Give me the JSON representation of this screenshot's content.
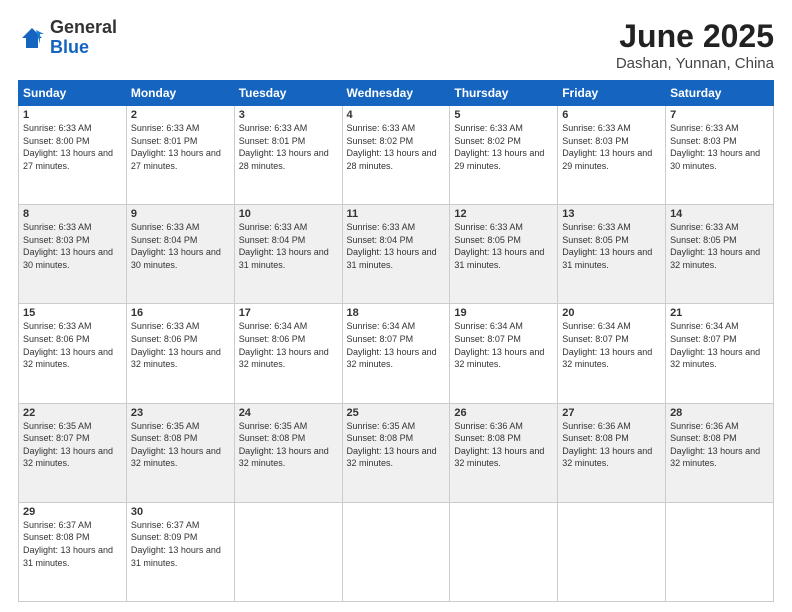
{
  "logo": {
    "general": "General",
    "blue": "Blue"
  },
  "title": {
    "month_year": "June 2025",
    "location": "Dashan, Yunnan, China"
  },
  "weekdays": [
    "Sunday",
    "Monday",
    "Tuesday",
    "Wednesday",
    "Thursday",
    "Friday",
    "Saturday"
  ],
  "weeks": [
    [
      {
        "day": "1",
        "sunrise": "6:33 AM",
        "sunset": "8:00 PM",
        "daylight": "13 hours and 27 minutes."
      },
      {
        "day": "2",
        "sunrise": "6:33 AM",
        "sunset": "8:01 PM",
        "daylight": "13 hours and 27 minutes."
      },
      {
        "day": "3",
        "sunrise": "6:33 AM",
        "sunset": "8:01 PM",
        "daylight": "13 hours and 28 minutes."
      },
      {
        "day": "4",
        "sunrise": "6:33 AM",
        "sunset": "8:02 PM",
        "daylight": "13 hours and 28 minutes."
      },
      {
        "day": "5",
        "sunrise": "6:33 AM",
        "sunset": "8:02 PM",
        "daylight": "13 hours and 29 minutes."
      },
      {
        "day": "6",
        "sunrise": "6:33 AM",
        "sunset": "8:03 PM",
        "daylight": "13 hours and 29 minutes."
      },
      {
        "day": "7",
        "sunrise": "6:33 AM",
        "sunset": "8:03 PM",
        "daylight": "13 hours and 30 minutes."
      }
    ],
    [
      {
        "day": "8",
        "sunrise": "6:33 AM",
        "sunset": "8:03 PM",
        "daylight": "13 hours and 30 minutes."
      },
      {
        "day": "9",
        "sunrise": "6:33 AM",
        "sunset": "8:04 PM",
        "daylight": "13 hours and 30 minutes."
      },
      {
        "day": "10",
        "sunrise": "6:33 AM",
        "sunset": "8:04 PM",
        "daylight": "13 hours and 31 minutes."
      },
      {
        "day": "11",
        "sunrise": "6:33 AM",
        "sunset": "8:04 PM",
        "daylight": "13 hours and 31 minutes."
      },
      {
        "day": "12",
        "sunrise": "6:33 AM",
        "sunset": "8:05 PM",
        "daylight": "13 hours and 31 minutes."
      },
      {
        "day": "13",
        "sunrise": "6:33 AM",
        "sunset": "8:05 PM",
        "daylight": "13 hours and 31 minutes."
      },
      {
        "day": "14",
        "sunrise": "6:33 AM",
        "sunset": "8:05 PM",
        "daylight": "13 hours and 32 minutes."
      }
    ],
    [
      {
        "day": "15",
        "sunrise": "6:33 AM",
        "sunset": "8:06 PM",
        "daylight": "13 hours and 32 minutes."
      },
      {
        "day": "16",
        "sunrise": "6:33 AM",
        "sunset": "8:06 PM",
        "daylight": "13 hours and 32 minutes."
      },
      {
        "day": "17",
        "sunrise": "6:34 AM",
        "sunset": "8:06 PM",
        "daylight": "13 hours and 32 minutes."
      },
      {
        "day": "18",
        "sunrise": "6:34 AM",
        "sunset": "8:07 PM",
        "daylight": "13 hours and 32 minutes."
      },
      {
        "day": "19",
        "sunrise": "6:34 AM",
        "sunset": "8:07 PM",
        "daylight": "13 hours and 32 minutes."
      },
      {
        "day": "20",
        "sunrise": "6:34 AM",
        "sunset": "8:07 PM",
        "daylight": "13 hours and 32 minutes."
      },
      {
        "day": "21",
        "sunrise": "6:34 AM",
        "sunset": "8:07 PM",
        "daylight": "13 hours and 32 minutes."
      }
    ],
    [
      {
        "day": "22",
        "sunrise": "6:35 AM",
        "sunset": "8:07 PM",
        "daylight": "13 hours and 32 minutes."
      },
      {
        "day": "23",
        "sunrise": "6:35 AM",
        "sunset": "8:08 PM",
        "daylight": "13 hours and 32 minutes."
      },
      {
        "day": "24",
        "sunrise": "6:35 AM",
        "sunset": "8:08 PM",
        "daylight": "13 hours and 32 minutes."
      },
      {
        "day": "25",
        "sunrise": "6:35 AM",
        "sunset": "8:08 PM",
        "daylight": "13 hours and 32 minutes."
      },
      {
        "day": "26",
        "sunrise": "6:36 AM",
        "sunset": "8:08 PM",
        "daylight": "13 hours and 32 minutes."
      },
      {
        "day": "27",
        "sunrise": "6:36 AM",
        "sunset": "8:08 PM",
        "daylight": "13 hours and 32 minutes."
      },
      {
        "day": "28",
        "sunrise": "6:36 AM",
        "sunset": "8:08 PM",
        "daylight": "13 hours and 32 minutes."
      }
    ],
    [
      {
        "day": "29",
        "sunrise": "6:37 AM",
        "sunset": "8:08 PM",
        "daylight": "13 hours and 31 minutes."
      },
      {
        "day": "30",
        "sunrise": "6:37 AM",
        "sunset": "8:09 PM",
        "daylight": "13 hours and 31 minutes."
      },
      null,
      null,
      null,
      null,
      null
    ]
  ]
}
